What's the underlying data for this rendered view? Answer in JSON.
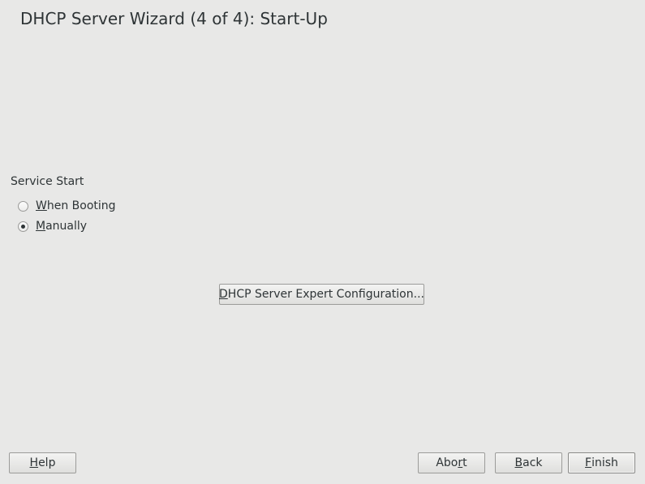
{
  "window": {
    "title": "DHCP Server Wizard (4 of 4): Start-Up"
  },
  "service_start": {
    "label": "Service Start",
    "options": [
      {
        "mnemonic": "W",
        "rest": "hen Booting",
        "checked": false
      },
      {
        "mnemonic": "M",
        "rest": "anually",
        "checked": true
      }
    ]
  },
  "expert_button": {
    "pre": "",
    "mnemonic": "D",
    "rest": "HCP Server Expert Configuration..."
  },
  "footer": {
    "help": {
      "pre": "",
      "mnemonic": "H",
      "rest": "elp"
    },
    "abort": {
      "pre": "Abo",
      "mnemonic": "r",
      "rest": "t"
    },
    "back": {
      "pre": "",
      "mnemonic": "B",
      "rest": "ack"
    },
    "finish": {
      "pre": "",
      "mnemonic": "F",
      "rest": "inish"
    }
  }
}
